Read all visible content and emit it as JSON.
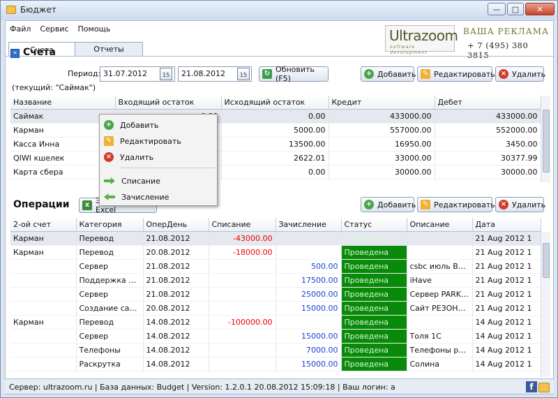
{
  "window": {
    "title": "Бюджет",
    "btn_min": "—",
    "btn_max": "□",
    "btn_close": "✕"
  },
  "menu": [
    "Файл",
    "Сервис",
    "Помощь"
  ],
  "tabs": [
    "Счета",
    "Отчеты"
  ],
  "ad": {
    "logo": "Ultrazoom",
    "logo_sub": "software development",
    "title": "ВАША РЕКЛАМА",
    "phone": "+ 7 (495) 380 3815"
  },
  "accounts": {
    "title": "Счета",
    "period_label": "Период:",
    "date_from": "31.07.2012",
    "date_to": "21.08.2012",
    "cal_label": "15",
    "refresh": "Обновить (F5)",
    "current": "(текущий: \"Саймак\")",
    "add": "Добавить",
    "edit": "Редактировать",
    "delete": "Удалить",
    "columns": [
      "Название",
      "Входящий остаток",
      "Исходящий остаток",
      "Кредит",
      "Дебет"
    ],
    "rows": [
      [
        "Саймак",
        "0.00",
        "0.00",
        "433000.00",
        "433000.00"
      ],
      [
        "Карман",
        "0",
        "5000.00",
        "557000.00",
        "552000.00"
      ],
      [
        "Касса Инна",
        "0",
        "13500.00",
        "16950.00",
        "3450.00"
      ],
      [
        "QIWI кшелек",
        "0",
        "2622.01",
        "33000.00",
        "30377.99"
      ],
      [
        "Карта сбера",
        "0",
        "0.00",
        "30000.00",
        "30000.00"
      ]
    ]
  },
  "context_menu": {
    "add": "Добавить",
    "edit": "Редактировать",
    "delete": "Удалить",
    "writeoff": "Списание",
    "credit": "Зачисление"
  },
  "operations": {
    "title": "Операции",
    "export": "Экспорт в Excel",
    "add": "Добавить",
    "edit": "Редактировать",
    "delete": "Удалить",
    "columns": [
      "2-ой счет",
      "Категория",
      "ОперДень",
      "Списание",
      "Зачисление",
      "Статус",
      "Описание",
      "Дата"
    ],
    "rows": [
      [
        "Карман",
        "Перевод",
        "21.08.2012",
        "-43000.00",
        "",
        "Проведена",
        "",
        "21 Aug 2012 1"
      ],
      [
        "Карман",
        "Перевод",
        "20.08.2012",
        "-18000.00",
        "",
        "Проведена",
        "",
        "21 Aug 2012 1"
      ],
      [
        "",
        "Сервер",
        "21.08.2012",
        "",
        "500.00",
        "Проведена",
        "csbc июль Вальс",
        "21 Aug 2012 1"
      ],
      [
        "",
        "Поддержка са...",
        "21.08.2012",
        "",
        "17500.00",
        "Проведена",
        "iHave",
        "21 Aug 2012 1"
      ],
      [
        "",
        "Сервер",
        "21.08.2012",
        "",
        "25000.00",
        "Проведена",
        "Сервер PARKI...",
        "21 Aug 2012 1"
      ],
      [
        "",
        "Создание сайт...",
        "20.08.2012",
        "",
        "15000.00",
        "Проведена",
        "Сайт РЕЗОНАН...",
        "21 Aug 2012 1"
      ],
      [
        "Карман",
        "Перевод",
        "14.08.2012",
        "-100000.00",
        "",
        "Проведена",
        "",
        "14 Aug 2012 1"
      ],
      [
        "",
        "Сервер",
        "14.08.2012",
        "",
        "15000.00",
        "Проведена",
        "Толя 1С",
        "14 Aug 2012 1"
      ],
      [
        "",
        "Телефоны",
        "14.08.2012",
        "",
        "7000.00",
        "Проведена",
        "Телефоны рез...",
        "14 Aug 2012 1"
      ],
      [
        "",
        "Раскрутка",
        "14.08.2012",
        "",
        "15000.00",
        "Проведена",
        "Солина",
        "14 Aug 2012 1"
      ]
    ]
  },
  "statusbar": "Сервер: ultrazoom.ru  |  База данных: Budget  |  Version: 1.2.0.1 20.08.2012 15:09:18  |  Ваш логин: a",
  "icons": {
    "add": "plus-circle-icon",
    "edit": "pencil-icon",
    "delete": "x-circle-icon",
    "refresh": "refresh-icon",
    "calendar": "calendar-icon",
    "facebook": "facebook-icon",
    "folder": "folder-icon"
  }
}
